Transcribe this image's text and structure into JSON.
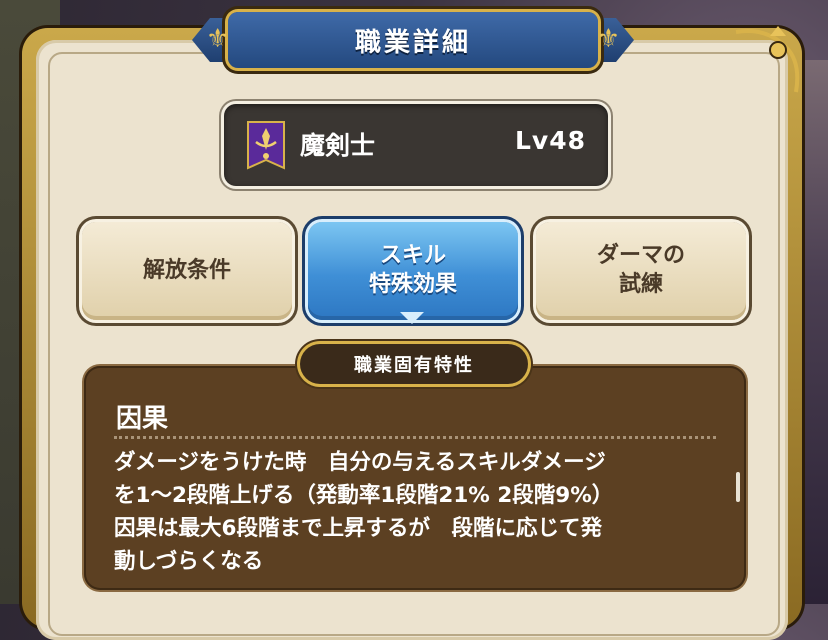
{
  "title": "職業詳細",
  "job": {
    "name": "魔剣士",
    "level": "Lv48",
    "emblem_icon": "magic-swordsman-emblem-icon"
  },
  "tabs": [
    {
      "line1": "解放条件",
      "line2": "",
      "selected": false
    },
    {
      "line1": "スキル",
      "line2": "特殊効果",
      "selected": true
    },
    {
      "line1": "ダーマの",
      "line2": "試練",
      "selected": false
    }
  ],
  "section_label": "職業固有特性",
  "trait": {
    "name": "因果",
    "description_lines": [
      "ダメージをうけた時　自分の与えるスキルダメージ",
      "を1～2段階上げる（発動率1段階21% 2段階9%）",
      "因果は最大6段階まで上昇するが　段階に応じて発",
      "動しづらくなる"
    ]
  },
  "colors": {
    "title_blue": "#24497f",
    "tab_selected": "#3f8fd6",
    "panel_brown": "#5c4022",
    "gold": "#d8b24a"
  }
}
